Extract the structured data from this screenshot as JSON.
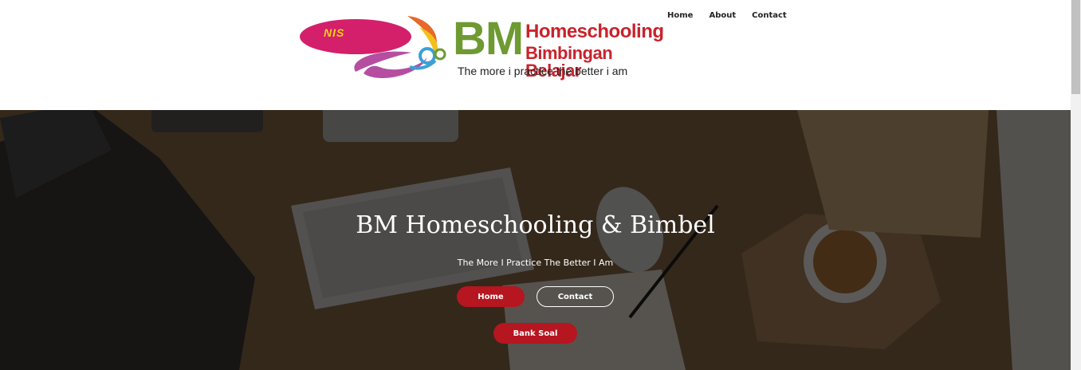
{
  "logo": {
    "badge": "NIS",
    "mark": "BM",
    "line1": "Homeschooling",
    "line2": "Bimbingan Belajar",
    "tagline": "The more i practice the better i am"
  },
  "nav": {
    "items": [
      {
        "label": "Home"
      },
      {
        "label": "About"
      },
      {
        "label": "Contact"
      }
    ]
  },
  "hero": {
    "title": "BM Homeschooling & Bimbel",
    "subtitle": "The More I Practice The Better I Am",
    "buttons": {
      "home": "Home",
      "contact": "Contact",
      "bank": "Bank Soal"
    }
  },
  "colors": {
    "accent": "#b5161f",
    "logo_green": "#6e9a32",
    "logo_red": "#c8232c"
  }
}
